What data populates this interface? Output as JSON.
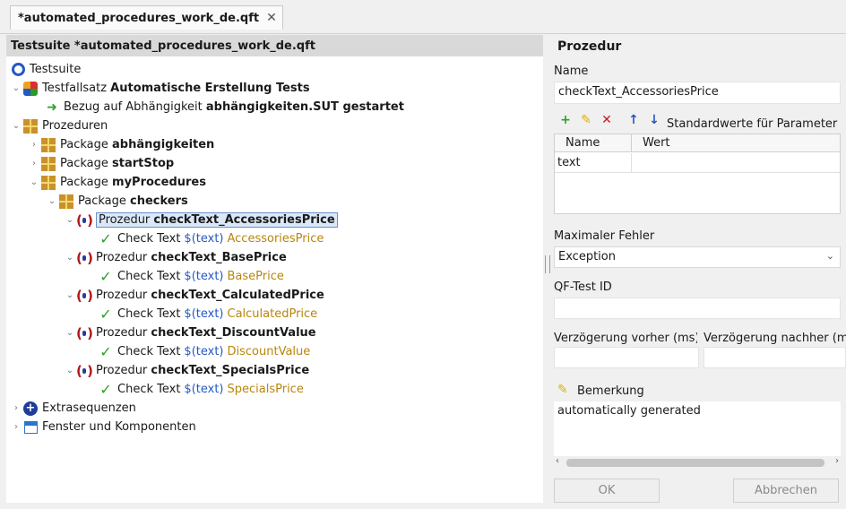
{
  "tab": {
    "title": "*automated_procedures_work_de.qft",
    "close": "✕"
  },
  "tree": {
    "header": "Testsuite *automated_procedures_work_de.qft",
    "rows": {
      "testsuite": "Testsuite",
      "tfs_prefix": "Testfallsatz",
      "tfs_name": "Automatische Erstellung Tests",
      "dep_prefix": "Bezug auf Abhängigkeit",
      "dep_name": "abhängigkeiten.SUT gestartet",
      "procedures": "Prozeduren",
      "pkg_prefix": "Package",
      "pkg1": "abhängigkeiten",
      "pkg2": "startStop",
      "pkg3": "myProcedures",
      "pkg4": "checkers",
      "proc_prefix": "Prozedur",
      "check_prefix": "Check Text",
      "var": "$(text)",
      "proc1": "checkText_AccessoriesPrice",
      "val1": "AccessoriesPrice",
      "proc2": "checkText_BasePrice",
      "val2": "BasePrice",
      "proc3": "checkText_CalculatedPrice",
      "val3": "CalculatedPrice",
      "proc4": "checkText_DiscountValue",
      "val4": "DiscountValue",
      "proc5": "checkText_SpecialsPrice",
      "val5": "SpecialsPrice",
      "extras": "Extrasequenzen",
      "windows": "Fenster und Komponenten"
    }
  },
  "detail": {
    "title": "Prozedur",
    "name_label": "Name",
    "name_value": "checkText_AccessoriesPrice",
    "params_label": "Standardwerte für Parameter",
    "col_name": "Name",
    "col_value": "Wert",
    "param_name": "text",
    "param_value": "",
    "max_error_label": "Maximaler Fehler",
    "max_error_value": "Exception",
    "qftest_id_label": "QF-Test ID",
    "qftest_id_value": "",
    "delay_before_label": "Verzögerung vorher (ms)",
    "delay_after_label": "Verzögerung nachher (ms)",
    "remark_label": "Bemerkung",
    "remark_value": "automatically generated",
    "ok_button": "OK",
    "cancel_button": "Abbrechen"
  },
  "colors": {
    "selection": "#dbe8f8",
    "variable": "#2359c4",
    "value": "#b8860b",
    "add": "#2aa12a",
    "delete": "#d01818",
    "move": "#2359c4"
  }
}
